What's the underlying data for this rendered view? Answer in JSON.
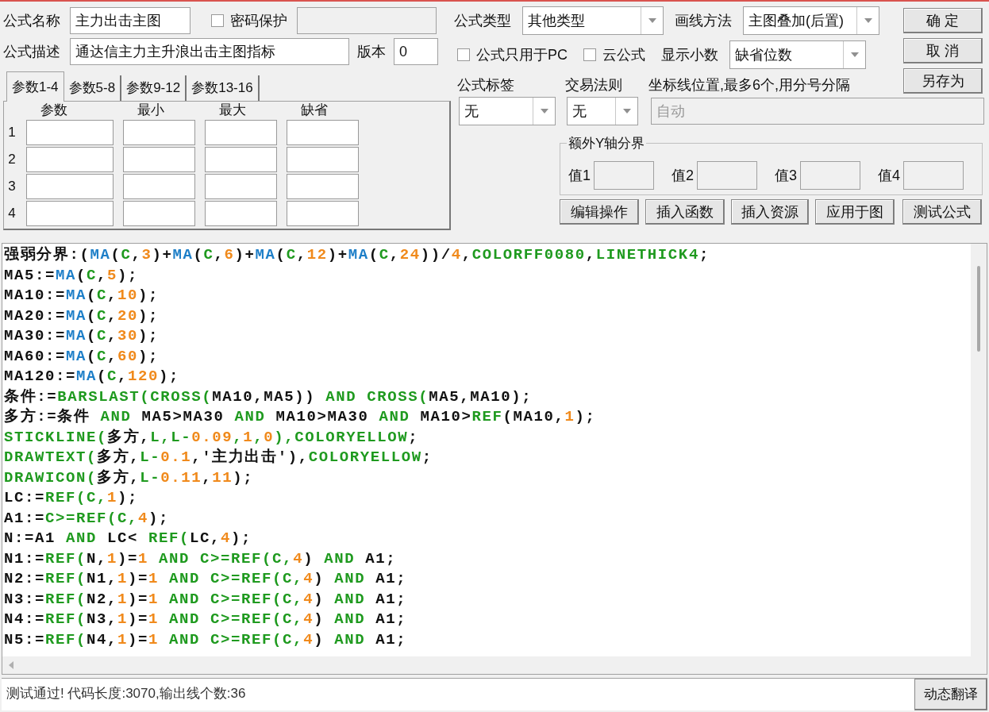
{
  "formula_name": {
    "label": "公式名称",
    "value": "主力出击主图"
  },
  "password": {
    "label": "密码保护",
    "checked": false
  },
  "formula_type": {
    "label": "公式类型",
    "value": "其他类型"
  },
  "draw_method": {
    "label": "画线方法",
    "value": "主图叠加(后置)"
  },
  "description": {
    "label": "公式描述",
    "value": "通达信主力主升浪出击主图指标"
  },
  "version": {
    "label": "版本",
    "value": "0"
  },
  "pc_only": {
    "label": "公式只用于PC",
    "checked": false
  },
  "cloud": {
    "label": "云公式",
    "checked": false
  },
  "decimals": {
    "label": "显示小数",
    "value": "缺省位数"
  },
  "buttons": [
    "确 定",
    "取 消",
    "另存为"
  ],
  "param_tabs": [
    {
      "label": "参数1-4",
      "selected": true
    },
    {
      "label": "参数5-8",
      "selected": false
    },
    {
      "label": "参数9-12",
      "selected": false
    },
    {
      "label": "参数13-16",
      "selected": false
    }
  ],
  "param_columns": [
    "参数",
    "最小",
    "最大",
    "缺省"
  ],
  "param_rows": [
    "1",
    "2",
    "3",
    "4"
  ],
  "formula_tag": {
    "label": "公式标签",
    "value": "无"
  },
  "trade_rule": {
    "label": "交易法则",
    "value": "无"
  },
  "axis_lines": {
    "label": "坐标线位置,最多6个,用分号分隔",
    "value": "自动",
    "disabled": true
  },
  "extra_y": {
    "title": "额外Y轴分界",
    "fields": [
      "值1",
      "值2",
      "值3",
      "值4"
    ]
  },
  "actions": [
    "编辑操作",
    "插入函数",
    "插入资源",
    "应用于图",
    "测试公式"
  ],
  "code_lines": [
    [
      {
        "kind": "plain",
        "text": "强弱分界:("
      },
      {
        "kind": "builtin",
        "text": "MA"
      },
      {
        "kind": "plain",
        "text": "("
      },
      {
        "kind": "keyword",
        "text": "C"
      },
      {
        "kind": "plain",
        "text": ","
      },
      {
        "kind": "number",
        "text": "3"
      },
      {
        "kind": "plain",
        "text": ")+"
      },
      {
        "kind": "builtin",
        "text": "MA"
      },
      {
        "kind": "plain",
        "text": "("
      },
      {
        "kind": "keyword",
        "text": "C"
      },
      {
        "kind": "plain",
        "text": ","
      },
      {
        "kind": "number",
        "text": "6"
      },
      {
        "kind": "plain",
        "text": ")+"
      },
      {
        "kind": "builtin",
        "text": "MA"
      },
      {
        "kind": "plain",
        "text": "("
      },
      {
        "kind": "keyword",
        "text": "C"
      },
      {
        "kind": "plain",
        "text": ","
      },
      {
        "kind": "number",
        "text": "12"
      },
      {
        "kind": "plain",
        "text": ")+"
      },
      {
        "kind": "builtin",
        "text": "MA"
      },
      {
        "kind": "plain",
        "text": "("
      },
      {
        "kind": "keyword",
        "text": "C"
      },
      {
        "kind": "plain",
        "text": ","
      },
      {
        "kind": "number",
        "text": "24"
      },
      {
        "kind": "plain",
        "text": "))/"
      },
      {
        "kind": "number",
        "text": "4"
      },
      {
        "kind": "plain",
        "text": ","
      },
      {
        "kind": "keyword",
        "text": "COLORFF0080"
      },
      {
        "kind": "plain",
        "text": ","
      },
      {
        "kind": "keyword",
        "text": "LINETHICK4"
      },
      {
        "kind": "plain",
        "text": ";"
      }
    ],
    [
      {
        "kind": "plain",
        "text": "MA5:="
      },
      {
        "kind": "builtin",
        "text": "MA"
      },
      {
        "kind": "plain",
        "text": "("
      },
      {
        "kind": "keyword",
        "text": "C"
      },
      {
        "kind": "plain",
        "text": ","
      },
      {
        "kind": "number",
        "text": "5"
      },
      {
        "kind": "plain",
        "text": ");"
      }
    ],
    [
      {
        "kind": "plain",
        "text": "MA10:="
      },
      {
        "kind": "builtin",
        "text": "MA"
      },
      {
        "kind": "plain",
        "text": "("
      },
      {
        "kind": "keyword",
        "text": "C"
      },
      {
        "kind": "plain",
        "text": ","
      },
      {
        "kind": "number",
        "text": "10"
      },
      {
        "kind": "plain",
        "text": ");"
      }
    ],
    [
      {
        "kind": "plain",
        "text": "MA20:="
      },
      {
        "kind": "builtin",
        "text": "MA"
      },
      {
        "kind": "plain",
        "text": "("
      },
      {
        "kind": "keyword",
        "text": "C"
      },
      {
        "kind": "plain",
        "text": ","
      },
      {
        "kind": "number",
        "text": "20"
      },
      {
        "kind": "plain",
        "text": ");"
      }
    ],
    [
      {
        "kind": "plain",
        "text": "MA30:="
      },
      {
        "kind": "builtin",
        "text": "MA"
      },
      {
        "kind": "plain",
        "text": "("
      },
      {
        "kind": "keyword",
        "text": "C"
      },
      {
        "kind": "plain",
        "text": ","
      },
      {
        "kind": "number",
        "text": "30"
      },
      {
        "kind": "plain",
        "text": ");"
      }
    ],
    [
      {
        "kind": "plain",
        "text": "MA60:="
      },
      {
        "kind": "builtin",
        "text": "MA"
      },
      {
        "kind": "plain",
        "text": "("
      },
      {
        "kind": "keyword",
        "text": "C"
      },
      {
        "kind": "plain",
        "text": ","
      },
      {
        "kind": "number",
        "text": "60"
      },
      {
        "kind": "plain",
        "text": ");"
      }
    ],
    [
      {
        "kind": "plain",
        "text": "MA120:="
      },
      {
        "kind": "builtin",
        "text": "MA"
      },
      {
        "kind": "plain",
        "text": "("
      },
      {
        "kind": "keyword",
        "text": "C"
      },
      {
        "kind": "plain",
        "text": ","
      },
      {
        "kind": "number",
        "text": "120"
      },
      {
        "kind": "plain",
        "text": ");"
      }
    ],
    [
      {
        "kind": "plain",
        "text": "条件:="
      },
      {
        "kind": "keyword",
        "text": "BARSLAST(CROSS("
      },
      {
        "kind": "plain",
        "text": "MA10,MA5)) "
      },
      {
        "kind": "keyword",
        "text": "AND CROSS("
      },
      {
        "kind": "plain",
        "text": "MA5,MA10);"
      }
    ],
    [
      {
        "kind": "plain",
        "text": "多方:=条件 "
      },
      {
        "kind": "keyword",
        "text": "AND"
      },
      {
        "kind": "plain",
        "text": " MA5>MA30 "
      },
      {
        "kind": "keyword",
        "text": "AND"
      },
      {
        "kind": "plain",
        "text": " MA10>MA30 "
      },
      {
        "kind": "keyword",
        "text": "AND"
      },
      {
        "kind": "plain",
        "text": " MA10>"
      },
      {
        "kind": "keyword",
        "text": "REF"
      },
      {
        "kind": "plain",
        "text": "(MA10,"
      },
      {
        "kind": "number",
        "text": "1"
      },
      {
        "kind": "plain",
        "text": ");"
      }
    ],
    [
      {
        "kind": "keyword",
        "text": "STICKLINE("
      },
      {
        "kind": "plain",
        "text": "多方,"
      },
      {
        "kind": "keyword",
        "text": "L,L-"
      },
      {
        "kind": "number",
        "text": "0.09"
      },
      {
        "kind": "keyword",
        "text": ","
      },
      {
        "kind": "number",
        "text": "1"
      },
      {
        "kind": "keyword",
        "text": ","
      },
      {
        "kind": "number",
        "text": "0"
      },
      {
        "kind": "keyword",
        "text": "),COLORYELLOW"
      },
      {
        "kind": "plain",
        "text": ";"
      }
    ],
    [
      {
        "kind": "keyword",
        "text": "DRAWTEXT("
      },
      {
        "kind": "plain",
        "text": "多方,"
      },
      {
        "kind": "keyword",
        "text": "L-"
      },
      {
        "kind": "number",
        "text": "0.1"
      },
      {
        "kind": "plain",
        "text": ",'主力出击'),"
      },
      {
        "kind": "keyword",
        "text": "COLORYELLOW"
      },
      {
        "kind": "plain",
        "text": ";"
      }
    ],
    [
      {
        "kind": "keyword",
        "text": "DRAWICON("
      },
      {
        "kind": "plain",
        "text": "多方,"
      },
      {
        "kind": "keyword",
        "text": "L-"
      },
      {
        "kind": "number",
        "text": "0.11"
      },
      {
        "kind": "plain",
        "text": ","
      },
      {
        "kind": "number",
        "text": "11"
      },
      {
        "kind": "plain",
        "text": ");"
      }
    ],
    [
      {
        "kind": "plain",
        "text": "LC:="
      },
      {
        "kind": "keyword",
        "text": "REF(C,"
      },
      {
        "kind": "number",
        "text": "1"
      },
      {
        "kind": "plain",
        "text": ");"
      }
    ],
    [
      {
        "kind": "plain",
        "text": "A1:="
      },
      {
        "kind": "keyword",
        "text": "C>=REF(C,"
      },
      {
        "kind": "number",
        "text": "4"
      },
      {
        "kind": "plain",
        "text": ");"
      }
    ],
    [
      {
        "kind": "plain",
        "text": "N:=A1 "
      },
      {
        "kind": "keyword",
        "text": "AND"
      },
      {
        "kind": "plain",
        "text": " LC< "
      },
      {
        "kind": "keyword",
        "text": "REF("
      },
      {
        "kind": "plain",
        "text": "LC,"
      },
      {
        "kind": "number",
        "text": "4"
      },
      {
        "kind": "plain",
        "text": ");"
      }
    ],
    [
      {
        "kind": "plain",
        "text": "N1:="
      },
      {
        "kind": "keyword",
        "text": "REF("
      },
      {
        "kind": "plain",
        "text": "N,"
      },
      {
        "kind": "number",
        "text": "1"
      },
      {
        "kind": "plain",
        "text": ")="
      },
      {
        "kind": "number",
        "text": "1"
      },
      {
        "kind": "keyword",
        "text": " AND "
      },
      {
        "kind": "keyword",
        "text": "C>=REF(C,"
      },
      {
        "kind": "number",
        "text": "4"
      },
      {
        "kind": "plain",
        "text": ") "
      },
      {
        "kind": "keyword",
        "text": "AND"
      },
      {
        "kind": "plain",
        "text": " A1;"
      }
    ],
    [
      {
        "kind": "plain",
        "text": "N2:="
      },
      {
        "kind": "keyword",
        "text": "REF("
      },
      {
        "kind": "plain",
        "text": "N1,"
      },
      {
        "kind": "number",
        "text": "1"
      },
      {
        "kind": "plain",
        "text": ")="
      },
      {
        "kind": "number",
        "text": "1"
      },
      {
        "kind": "keyword",
        "text": " AND "
      },
      {
        "kind": "keyword",
        "text": "C>=REF(C,"
      },
      {
        "kind": "number",
        "text": "4"
      },
      {
        "kind": "plain",
        "text": ") "
      },
      {
        "kind": "keyword",
        "text": "AND"
      },
      {
        "kind": "plain",
        "text": " A1;"
      }
    ],
    [
      {
        "kind": "plain",
        "text": "N3:="
      },
      {
        "kind": "keyword",
        "text": "REF("
      },
      {
        "kind": "plain",
        "text": "N2,"
      },
      {
        "kind": "number",
        "text": "1"
      },
      {
        "kind": "plain",
        "text": ")="
      },
      {
        "kind": "number",
        "text": "1"
      },
      {
        "kind": "keyword",
        "text": " AND "
      },
      {
        "kind": "keyword",
        "text": "C>=REF(C,"
      },
      {
        "kind": "number",
        "text": "4"
      },
      {
        "kind": "plain",
        "text": ") "
      },
      {
        "kind": "keyword",
        "text": "AND"
      },
      {
        "kind": "plain",
        "text": " A1;"
      }
    ],
    [
      {
        "kind": "plain",
        "text": "N4:="
      },
      {
        "kind": "keyword",
        "text": "REF("
      },
      {
        "kind": "plain",
        "text": "N3,"
      },
      {
        "kind": "number",
        "text": "1"
      },
      {
        "kind": "plain",
        "text": ")="
      },
      {
        "kind": "number",
        "text": "1"
      },
      {
        "kind": "keyword",
        "text": " AND "
      },
      {
        "kind": "keyword",
        "text": "C>=REF(C,"
      },
      {
        "kind": "number",
        "text": "4"
      },
      {
        "kind": "plain",
        "text": ") "
      },
      {
        "kind": "keyword",
        "text": "AND"
      },
      {
        "kind": "plain",
        "text": " A1;"
      }
    ],
    [
      {
        "kind": "plain",
        "text": "N5:="
      },
      {
        "kind": "keyword",
        "text": "REF("
      },
      {
        "kind": "plain",
        "text": "N4,"
      },
      {
        "kind": "number",
        "text": "1"
      },
      {
        "kind": "plain",
        "text": ")="
      },
      {
        "kind": "number",
        "text": "1"
      },
      {
        "kind": "keyword",
        "text": " AND "
      },
      {
        "kind": "keyword",
        "text": "C>=REF(C,"
      },
      {
        "kind": "number",
        "text": "4"
      },
      {
        "kind": "plain",
        "text": ") "
      },
      {
        "kind": "keyword",
        "text": "AND"
      },
      {
        "kind": "plain",
        "text": " A1;"
      }
    ]
  ],
  "status": "测试通过! 代码长度:3070,输出线个数:36",
  "translate_button": "动态翻译"
}
